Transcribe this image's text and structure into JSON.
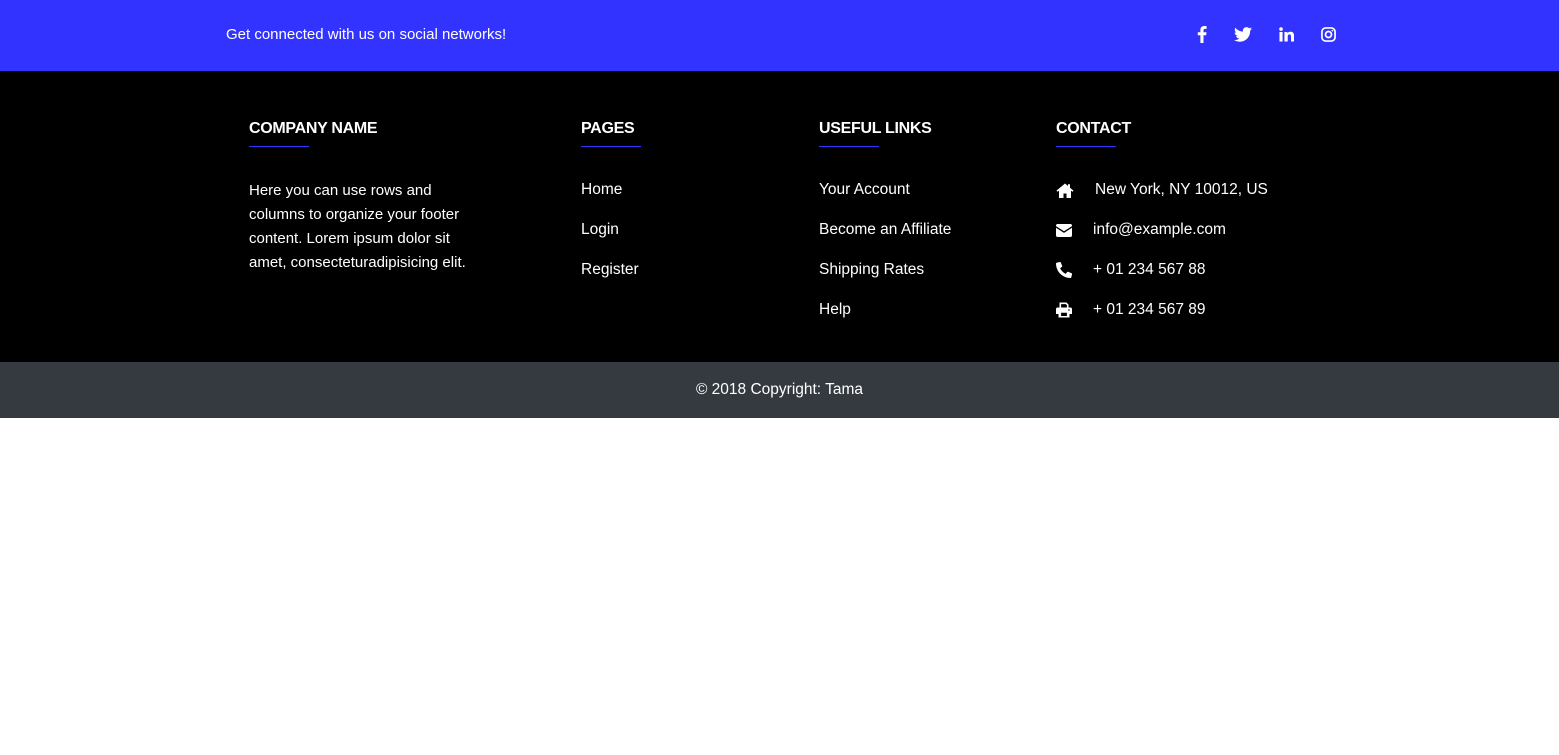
{
  "social_bar": {
    "text": "Get connected with us on social networks!",
    "background": "#3333ff",
    "icons": [
      {
        "name": "facebook-icon"
      },
      {
        "name": "twitter-icon"
      },
      {
        "name": "linkedin-icon"
      },
      {
        "name": "instagram-icon"
      }
    ]
  },
  "footer": {
    "background": "#000000",
    "accent": "#3333ff",
    "company": {
      "title": "COMPANY NAME",
      "text": "Here you can use rows and columns to organize your footer content. Lorem ipsum dolor sit amet, consecteturadipisicing elit."
    },
    "pages": {
      "title": "PAGES",
      "links": [
        "Home",
        "Login",
        "Register"
      ]
    },
    "useful_links": {
      "title": "USEFUL LINKS",
      "links": [
        "Your Account",
        "Become an Affiliate",
        "Shipping Rates",
        "Help"
      ]
    },
    "contact": {
      "title": "CONTACT",
      "items": [
        {
          "icon": "home-icon",
          "text": "New York, NY 10012, US"
        },
        {
          "icon": "envelope-icon",
          "text": "info@example.com"
        },
        {
          "icon": "phone-icon",
          "text": "+ 01 234 567 88"
        },
        {
          "icon": "print-icon",
          "text": "+ 01 234 567 89"
        }
      ]
    }
  },
  "copyright": {
    "prefix": "© 2018 Copyright: ",
    "link": "Tama",
    "background": "#343a40"
  }
}
